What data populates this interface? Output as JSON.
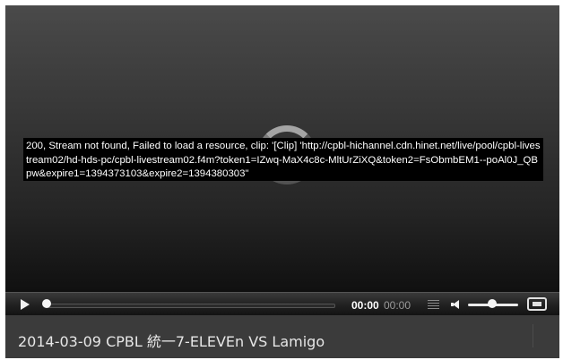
{
  "error_message": "200, Stream not found, Failed to load a resource, clip: '[Clip] 'http://cpbl-hichannel.cdn.hinet.net/live/pool/cpbl-livestream02/hd-hds-pc/cpbl-livestream02.f4m?token1=IZwq-MaX4c8c-MltUrZiXQ&token2=FsObmbEM1--poAl0J_QBpw&expire1=1394373103&expire2=1394380303\"",
  "controls": {
    "current_time": "00:00",
    "duration": "00:00",
    "seek_progress": 0,
    "volume_level": 0.45
  },
  "video_title": "2014-03-09 CPBL 統一7-ELEVEn VS Lamigo",
  "icons": [
    "play-icon",
    "playlist-icon",
    "volume-icon",
    "fullscreen-icon",
    "loading-spinner"
  ]
}
